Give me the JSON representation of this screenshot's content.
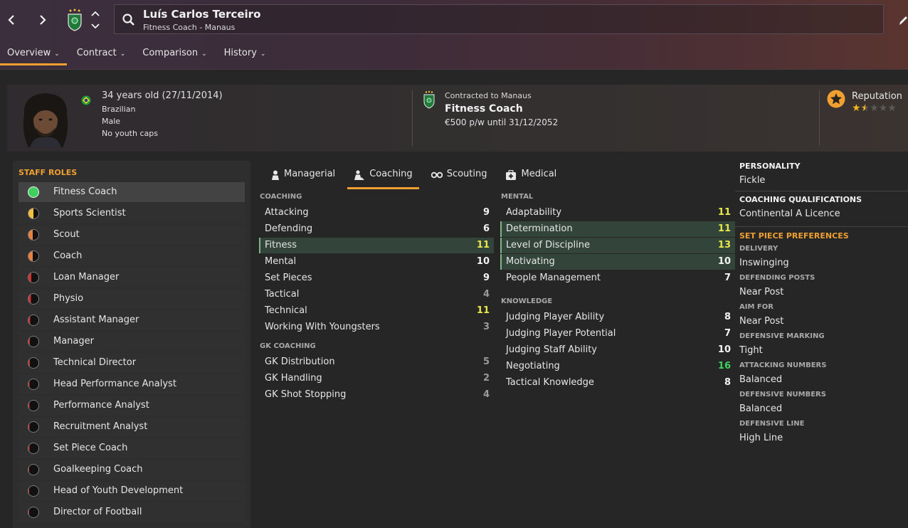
{
  "header": {
    "name": "Luís Carlos Terceiro",
    "subtitle": "Fitness Coach - Manaus",
    "tabs": [
      {
        "label": "Overview",
        "active": true
      },
      {
        "label": "Contract",
        "active": false
      },
      {
        "label": "Comparison",
        "active": false
      },
      {
        "label": "History",
        "active": false
      }
    ]
  },
  "profile": {
    "age": "34 years old (27/11/2014)",
    "nationality": "Brazilian",
    "gender": "Male",
    "youth_caps": "No youth caps",
    "contract_label": "Contracted to Manaus",
    "job": "Fitness Coach",
    "wage": "€500 p/w until 31/12/2052",
    "reputation_label": "Reputation",
    "reputation_stars": 1.5
  },
  "roles": {
    "title": "STAFF ROLES",
    "items": [
      {
        "label": "Fitness Coach",
        "fill": 1.0,
        "active": true
      },
      {
        "label": "Sports Scientist",
        "fill": 0.5,
        "active": false
      },
      {
        "label": "Scout",
        "fill": 0.42,
        "active": false
      },
      {
        "label": "Coach",
        "fill": 0.42,
        "active": false
      },
      {
        "label": "Loan Manager",
        "fill": 0.3,
        "active": false
      },
      {
        "label": "Physio",
        "fill": 0.25,
        "active": false
      },
      {
        "label": "Assistant Manager",
        "fill": 0.18,
        "active": false
      },
      {
        "label": "Manager",
        "fill": 0.15,
        "active": false
      },
      {
        "label": "Technical Director",
        "fill": 0.15,
        "active": false
      },
      {
        "label": "Head Performance Analyst",
        "fill": 0.12,
        "active": false
      },
      {
        "label": "Performance Analyst",
        "fill": 0.12,
        "active": false
      },
      {
        "label": "Recruitment Analyst",
        "fill": 0.1,
        "active": false
      },
      {
        "label": "Set Piece Coach",
        "fill": 0.1,
        "active": false
      },
      {
        "label": "Goalkeeping Coach",
        "fill": 0.08,
        "active": false
      },
      {
        "label": "Head of Youth Development",
        "fill": 0.08,
        "active": false
      },
      {
        "label": "Director of Football",
        "fill": 0.08,
        "active": false
      }
    ]
  },
  "attr_tabs": [
    {
      "label": "Managerial",
      "icon": "managerial-icon",
      "active": false
    },
    {
      "label": "Coaching",
      "icon": "coaching-icon",
      "active": true
    },
    {
      "label": "Scouting",
      "icon": "binoculars-icon",
      "active": false
    },
    {
      "label": "Medical",
      "icon": "medical-kit-icon",
      "active": false
    }
  ],
  "coaching": {
    "title": "COACHING",
    "rows": [
      {
        "name": "Attacking",
        "value": "9",
        "color": "white",
        "hl": false
      },
      {
        "name": "Defending",
        "value": "6",
        "color": "white",
        "hl": false
      },
      {
        "name": "Fitness",
        "value": "11",
        "color": "yellow",
        "hl": true
      },
      {
        "name": "Mental",
        "value": "10",
        "color": "white",
        "hl": false
      },
      {
        "name": "Set Pieces",
        "value": "9",
        "color": "white",
        "hl": false
      },
      {
        "name": "Tactical",
        "value": "4",
        "color": "grey",
        "hl": false
      },
      {
        "name": "Technical",
        "value": "11",
        "color": "yellow",
        "hl": false
      },
      {
        "name": "Working With Youngsters",
        "value": "3",
        "color": "grey",
        "hl": false
      }
    ]
  },
  "gk_coaching": {
    "title": "GK COACHING",
    "rows": [
      {
        "name": "GK Distribution",
        "value": "5",
        "color": "grey",
        "hl": false
      },
      {
        "name": "GK Handling",
        "value": "2",
        "color": "grey",
        "hl": false
      },
      {
        "name": "GK Shot Stopping",
        "value": "4",
        "color": "grey",
        "hl": false
      }
    ]
  },
  "mental": {
    "title": "MENTAL",
    "rows": [
      {
        "name": "Adaptability",
        "value": "11",
        "color": "yellow",
        "hl": false
      },
      {
        "name": "Determination",
        "value": "11",
        "color": "yellow",
        "hl": true
      },
      {
        "name": "Level of Discipline",
        "value": "13",
        "color": "yellow",
        "hl": true
      },
      {
        "name": "Motivating",
        "value": "10",
        "color": "white",
        "hl": true
      },
      {
        "name": "People Management",
        "value": "7",
        "color": "white",
        "hl": false
      }
    ]
  },
  "knowledge": {
    "title": "KNOWLEDGE",
    "rows": [
      {
        "name": "Judging Player Ability",
        "value": "8",
        "color": "white",
        "hl": false
      },
      {
        "name": "Judging Player Potential",
        "value": "7",
        "color": "white",
        "hl": false
      },
      {
        "name": "Judging Staff Ability",
        "value": "10",
        "color": "white",
        "hl": false
      },
      {
        "name": "Negotiating",
        "value": "16",
        "color": "green",
        "hl": false
      },
      {
        "name": "Tactical Knowledge",
        "value": "8",
        "color": "white",
        "hl": false
      }
    ]
  },
  "info": {
    "personality_title": "PERSONALITY",
    "personality": "Fickle",
    "qual_title": "COACHING QUALIFICATIONS",
    "qualification": "Continental A Licence",
    "setpiece_title": "SET PIECE PREFERENCES",
    "prefs": [
      {
        "label": "DELIVERY",
        "value": "Inswinging"
      },
      {
        "label": "DEFENDING POSTS",
        "value": "Near Post"
      },
      {
        "label": "AIM FOR",
        "value": "Near Post"
      },
      {
        "label": "DEFENSIVE MARKING",
        "value": "Tight"
      },
      {
        "label": "ATTACKING NUMBERS",
        "value": "Balanced"
      },
      {
        "label": "DEFENSIVE NUMBERS",
        "value": "Balanced"
      },
      {
        "label": "DEFENSIVE LINE",
        "value": "High Line"
      }
    ]
  },
  "colors": {
    "accent": "#f0a030",
    "role_full": "#3fd060",
    "role_mid": "#f2c040",
    "role_low": "#e88040",
    "role_poor": "#d03030"
  }
}
